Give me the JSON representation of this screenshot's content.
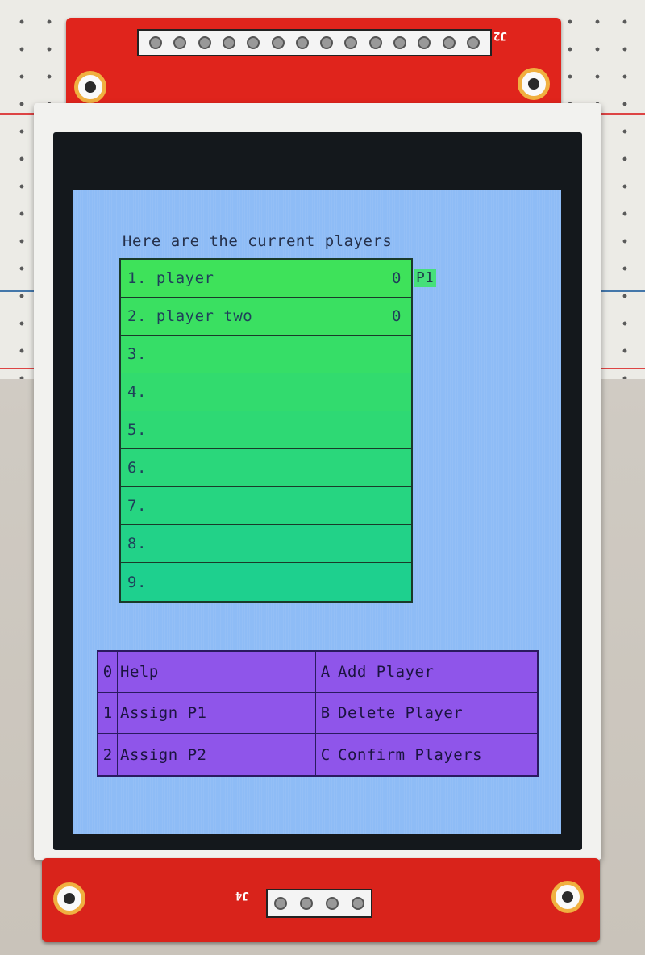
{
  "pcb": {
    "top_connector_label": "J2",
    "bottom_connector_label": "J4"
  },
  "screen": {
    "title": "Here are the current players",
    "players": [
      {
        "label": "1. player",
        "score": "0"
      },
      {
        "label": "2. player two",
        "score": "0"
      },
      {
        "label": "3.",
        "score": ""
      },
      {
        "label": "4.",
        "score": ""
      },
      {
        "label": "5.",
        "score": ""
      },
      {
        "label": "6.",
        "score": ""
      },
      {
        "label": "7.",
        "score": ""
      },
      {
        "label": "8.",
        "score": ""
      },
      {
        "label": "9.",
        "score": ""
      }
    ],
    "assignment_tag": "P1",
    "menu": [
      {
        "key": "0",
        "label": "Help",
        "key2": "A",
        "label2": "Add Player"
      },
      {
        "key": "1",
        "label": "Assign P1",
        "key2": "B",
        "label2": "Delete Player"
      },
      {
        "key": "2",
        "label": "Assign P2",
        "key2": "C",
        "label2": "Confirm Players"
      }
    ]
  },
  "colors": {
    "screen_bg": "#8ebcf6",
    "table_top": "#3ee25a",
    "table_bottom": "#1ed08e",
    "menu_bg": "#8f55ea"
  }
}
